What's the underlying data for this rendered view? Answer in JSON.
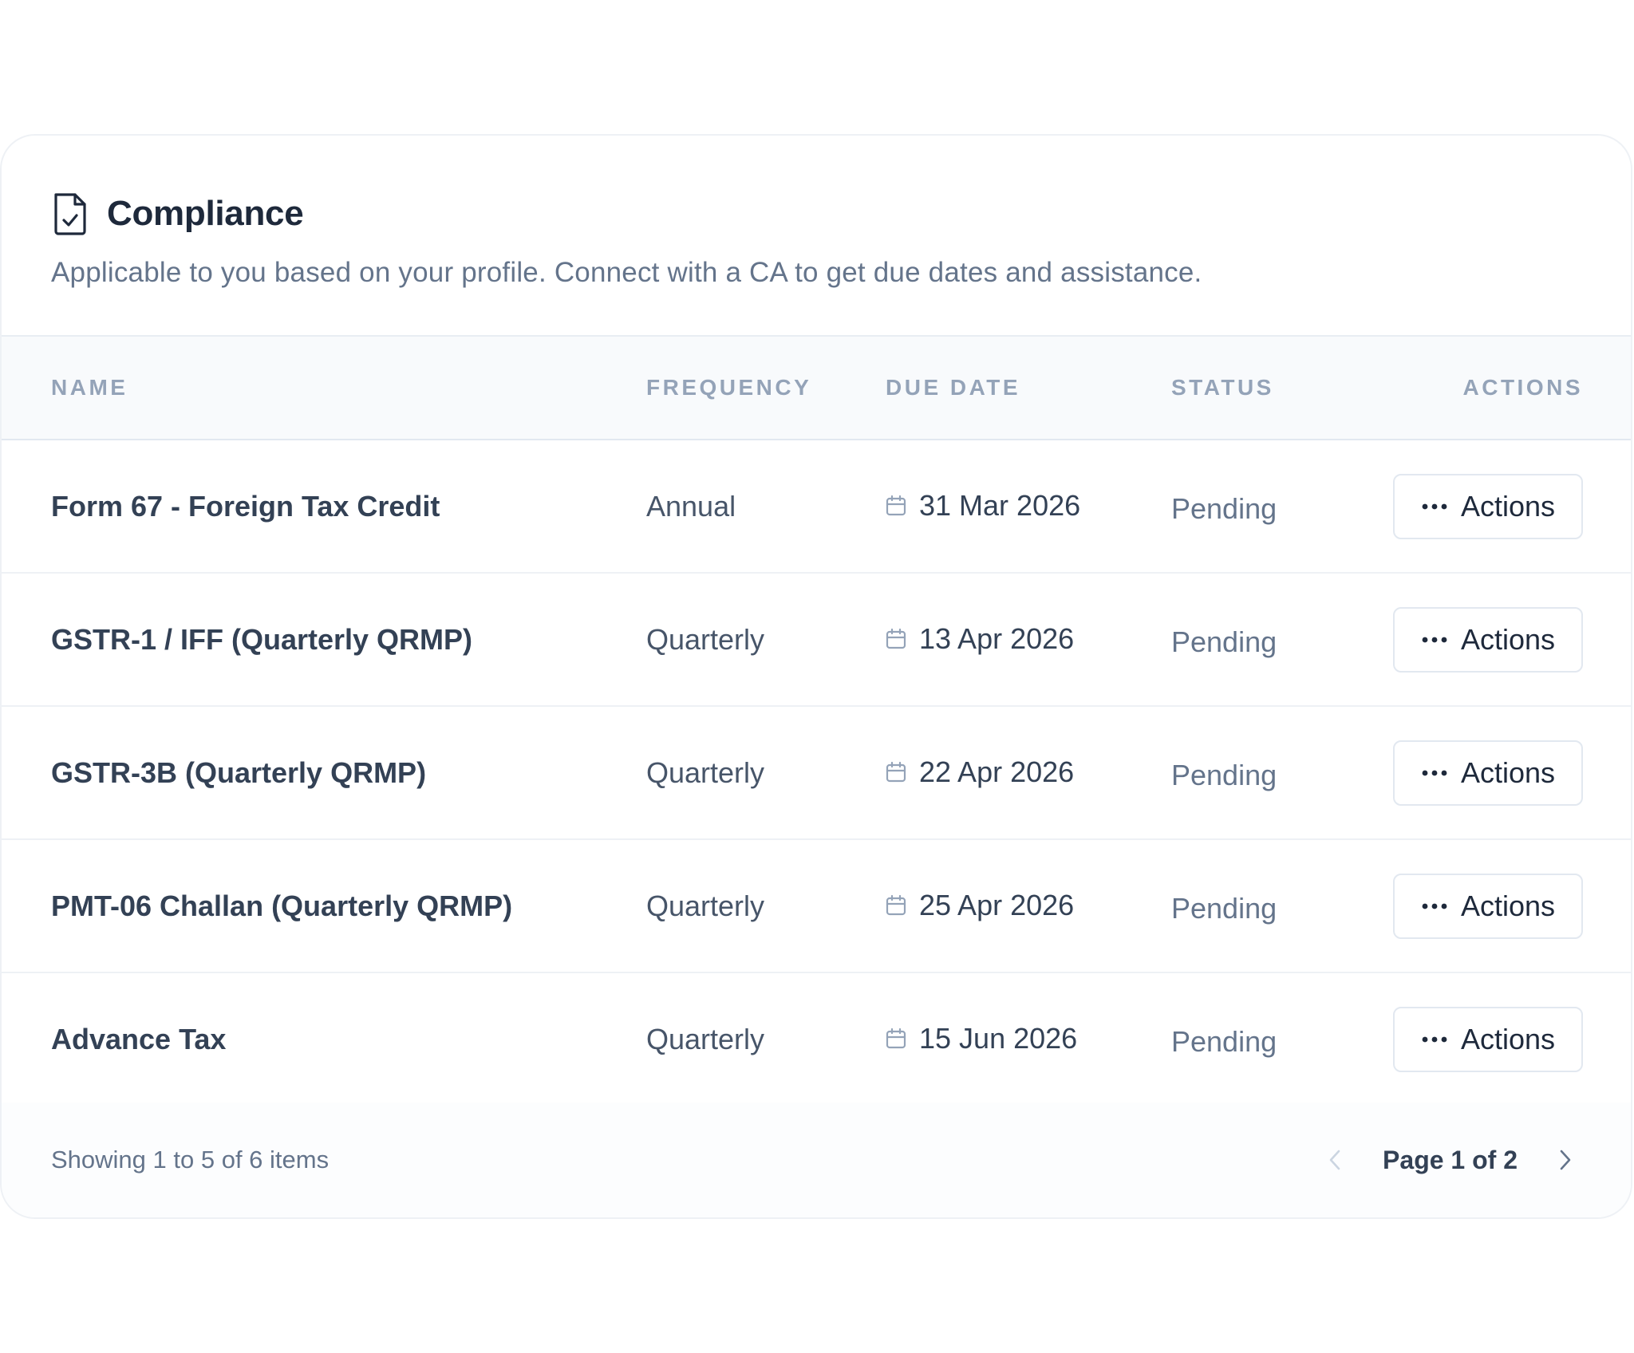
{
  "header": {
    "title": "Compliance",
    "subtitle": "Applicable to you based on your profile. Connect with a CA to get due dates and assistance.",
    "icon": "file-check-icon"
  },
  "table": {
    "columns": {
      "name": "NAME",
      "frequency": "FREQUENCY",
      "due_date": "DUE DATE",
      "status": "STATUS",
      "actions": "ACTIONS"
    },
    "rows": [
      {
        "name": "Form 67 - Foreign Tax Credit",
        "frequency": "Annual",
        "due_date": "31 Mar 2026",
        "status": "Pending",
        "action_label": "Actions"
      },
      {
        "name": "GSTR-1 / IFF (Quarterly QRMP)",
        "frequency": "Quarterly",
        "due_date": "13 Apr 2026",
        "status": "Pending",
        "action_label": "Actions"
      },
      {
        "name": "GSTR-3B (Quarterly QRMP)",
        "frequency": "Quarterly",
        "due_date": "22 Apr 2026",
        "status": "Pending",
        "action_label": "Actions"
      },
      {
        "name": "PMT-06 Challan (Quarterly QRMP)",
        "frequency": "Quarterly",
        "due_date": "25 Apr 2026",
        "status": "Pending",
        "action_label": "Actions"
      },
      {
        "name": "Advance Tax",
        "frequency": "Quarterly",
        "due_date": "15 Jun 2026",
        "status": "Pending",
        "action_label": "Actions"
      }
    ]
  },
  "footer": {
    "showing_text": "Showing 1 to 5 of 6 items",
    "page_label": "Page 1 of 2"
  },
  "colors": {
    "text_primary": "#1e293b",
    "text_muted": "#64748b",
    "header_text": "#94a3b8",
    "border": "#e2e8f0"
  }
}
